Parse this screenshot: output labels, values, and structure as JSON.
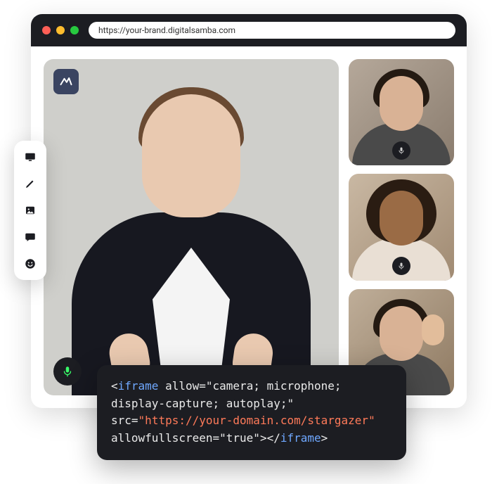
{
  "window": {
    "url": "https://your-brand.digitalsamba.com"
  },
  "toolbar": {
    "items": [
      {
        "name": "present-icon"
      },
      {
        "name": "pencil-icon"
      },
      {
        "name": "image-icon"
      },
      {
        "name": "chat-icon"
      },
      {
        "name": "emoji-icon"
      }
    ]
  },
  "logo": {
    "name": "brand-logo"
  },
  "main_video": {
    "mic_color": "#39ff6a"
  },
  "participants": [
    {
      "name": "participant-1",
      "mic_color": "#cfcfcf"
    },
    {
      "name": "participant-2",
      "mic_color": "#cfcfcf"
    },
    {
      "name": "participant-3",
      "mic_color": null
    }
  ],
  "code": {
    "lt": "<",
    "gt": ">",
    "slash": "/",
    "tag": "iframe",
    "attr_allow": "allow",
    "val_allow_a": "\"camera; microphone;",
    "val_allow_b": "display-capture; autoplay;\"",
    "attr_src": "src",
    "val_src": "\"https://your-domain.com/stargazer\"",
    "attr_fs": "allowfullscreen",
    "val_fs": "\"true\""
  }
}
